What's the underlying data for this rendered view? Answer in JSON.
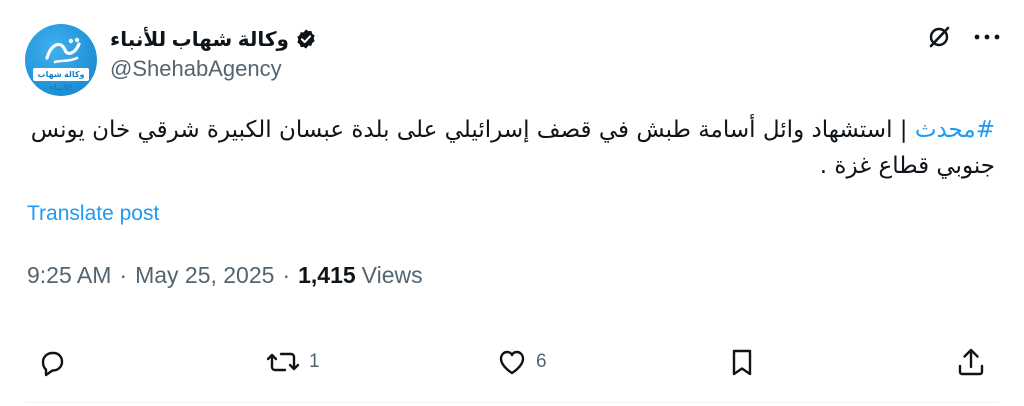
{
  "account": {
    "display_name": "وكالة شهاب للأنباء",
    "handle": "@ShehabAgency",
    "avatar_tag": "وكالة شهاب للأنباء",
    "avatar_glyph": "شهاب"
  },
  "post": {
    "hashtag": "#محدث",
    "text": " | استشهاد وائل أسامة طبش في قصف إسرائيلي على بلدة عبسان الكبيرة شرقي خان يونس جنوبي قطاع غزة .",
    "translate_label": "Translate post",
    "time": "9:25 AM",
    "date": "May 25, 2025",
    "views_count": "1,415",
    "views_label": "Views"
  },
  "actions": {
    "reply_count": "",
    "repost_count": "1",
    "like_count": "6"
  },
  "colors": {
    "accent": "#1d9bf0",
    "text": "#0f1419",
    "secondary": "#536471"
  },
  "icons": [
    "verified-badge-icon",
    "grok-icon",
    "more-icon",
    "reply-icon",
    "repost-icon",
    "like-icon",
    "bookmark-icon",
    "share-icon"
  ]
}
